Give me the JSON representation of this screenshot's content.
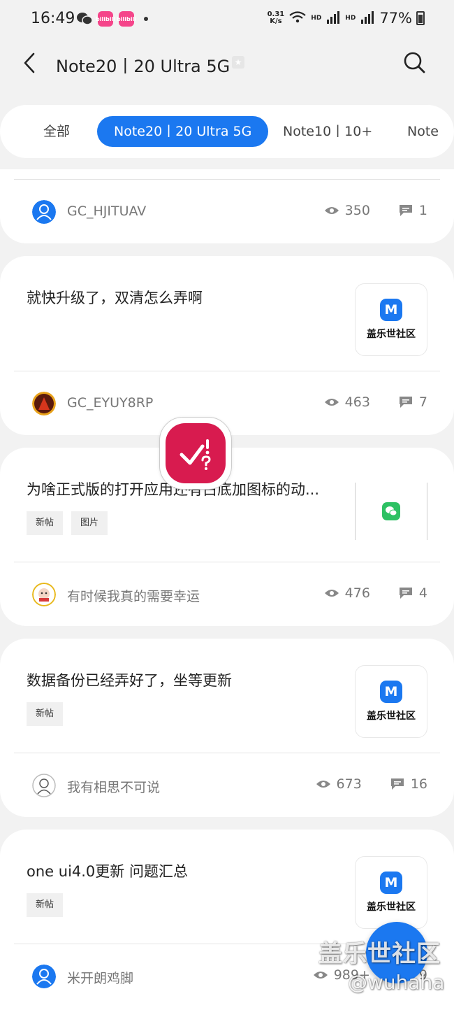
{
  "status_bar": {
    "time": "16:49",
    "net_speed_value": "0.31",
    "net_speed_unit": "K/s",
    "hd1": "HD",
    "hd2": "HD",
    "battery": "77%",
    "badge_label": "bilibili"
  },
  "header": {
    "title": "Note20丨20 Ultra 5G",
    "star_glyph": "★"
  },
  "tabs": [
    {
      "label": "全部"
    },
    {
      "label": "Note20丨20 Ultra 5G",
      "active": true
    },
    {
      "label": "Note10丨10+"
    },
    {
      "label": "Note"
    }
  ],
  "posts": [
    {
      "author": "GC_HJITUAV",
      "views": "350",
      "comments": "1"
    },
    {
      "title": "就快升级了，双清怎么弄啊",
      "thumb_text": "盖乐世社区",
      "thumb_logo": "M",
      "author": "GC_EYUY8RP",
      "views": "463",
      "comments": "7"
    },
    {
      "title": "为啥正式版的打开应用还有白底加图标的动...",
      "tags": [
        "新帖",
        "图片"
      ],
      "author": "有时候我真的需要幸运",
      "views": "476",
      "comments": "4"
    },
    {
      "title": "数据备份已经弄好了，坐等更新",
      "tags": [
        "新帖"
      ],
      "thumb_text": "盖乐世社区",
      "thumb_logo": "M",
      "author": "我有相思不可说",
      "views": "673",
      "comments": "16"
    },
    {
      "title": "one ui4.0更新 问题汇总",
      "tags": [
        "新帖"
      ],
      "thumb_text": "盖乐世社区",
      "thumb_logo": "M",
      "author": "米开朗鸡脚",
      "views": "989+",
      "comments": "9"
    }
  ],
  "watermark": {
    "line1": "盖乐世社区",
    "line2": "@wuhaha"
  },
  "colors": {
    "accent": "#1b78f0",
    "overlay": "#d81b4f"
  }
}
